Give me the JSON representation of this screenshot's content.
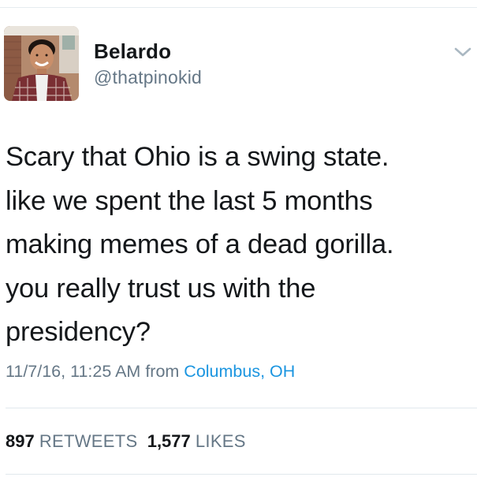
{
  "user": {
    "display_name": "Belardo",
    "handle": "@thatpinokid"
  },
  "tweet": {
    "lines": [
      "Scary that Ohio is a swing state.",
      "like we spent the last 5 months",
      "making memes of a dead gorilla.",
      "you really trust us with the",
      "presidency?"
    ]
  },
  "meta": {
    "timestamp": "11/7/16, 11:25 AM",
    "from": "from",
    "location": "Columbus, OH"
  },
  "stats": {
    "retweets_count": "897",
    "retweets_label": "RETWEETS",
    "likes_count": "1,577",
    "likes_label": "LIKES"
  },
  "icons": {
    "menu": "chevron-down-icon",
    "avatar": "avatar"
  },
  "colors": {
    "text": "#14171a",
    "secondary": "#657786",
    "link": "#1b95e0",
    "divider": "#e1e8ed"
  }
}
